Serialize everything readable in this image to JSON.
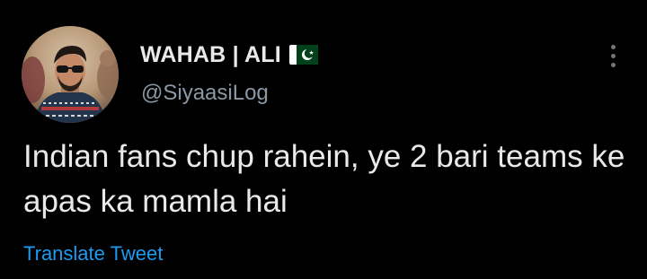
{
  "user": {
    "display_name": "WAHAB | ALI",
    "handle": "@SiyaasiLog",
    "flag_icon": "pakistan-flag-icon",
    "avatar_icon": "profile-photo"
  },
  "tweet": {
    "text": "Indian fans chup rahein, ye 2 bari teams ke apas ka mamla hai",
    "translate_label": "Translate Tweet"
  },
  "menu": {
    "icon": "more-vertical-icon"
  },
  "colors": {
    "background": "#000000",
    "text": "#e7e9ea",
    "secondary_text": "#8b98a5",
    "link": "#1d9bf0",
    "flag_green": "#01411c"
  }
}
